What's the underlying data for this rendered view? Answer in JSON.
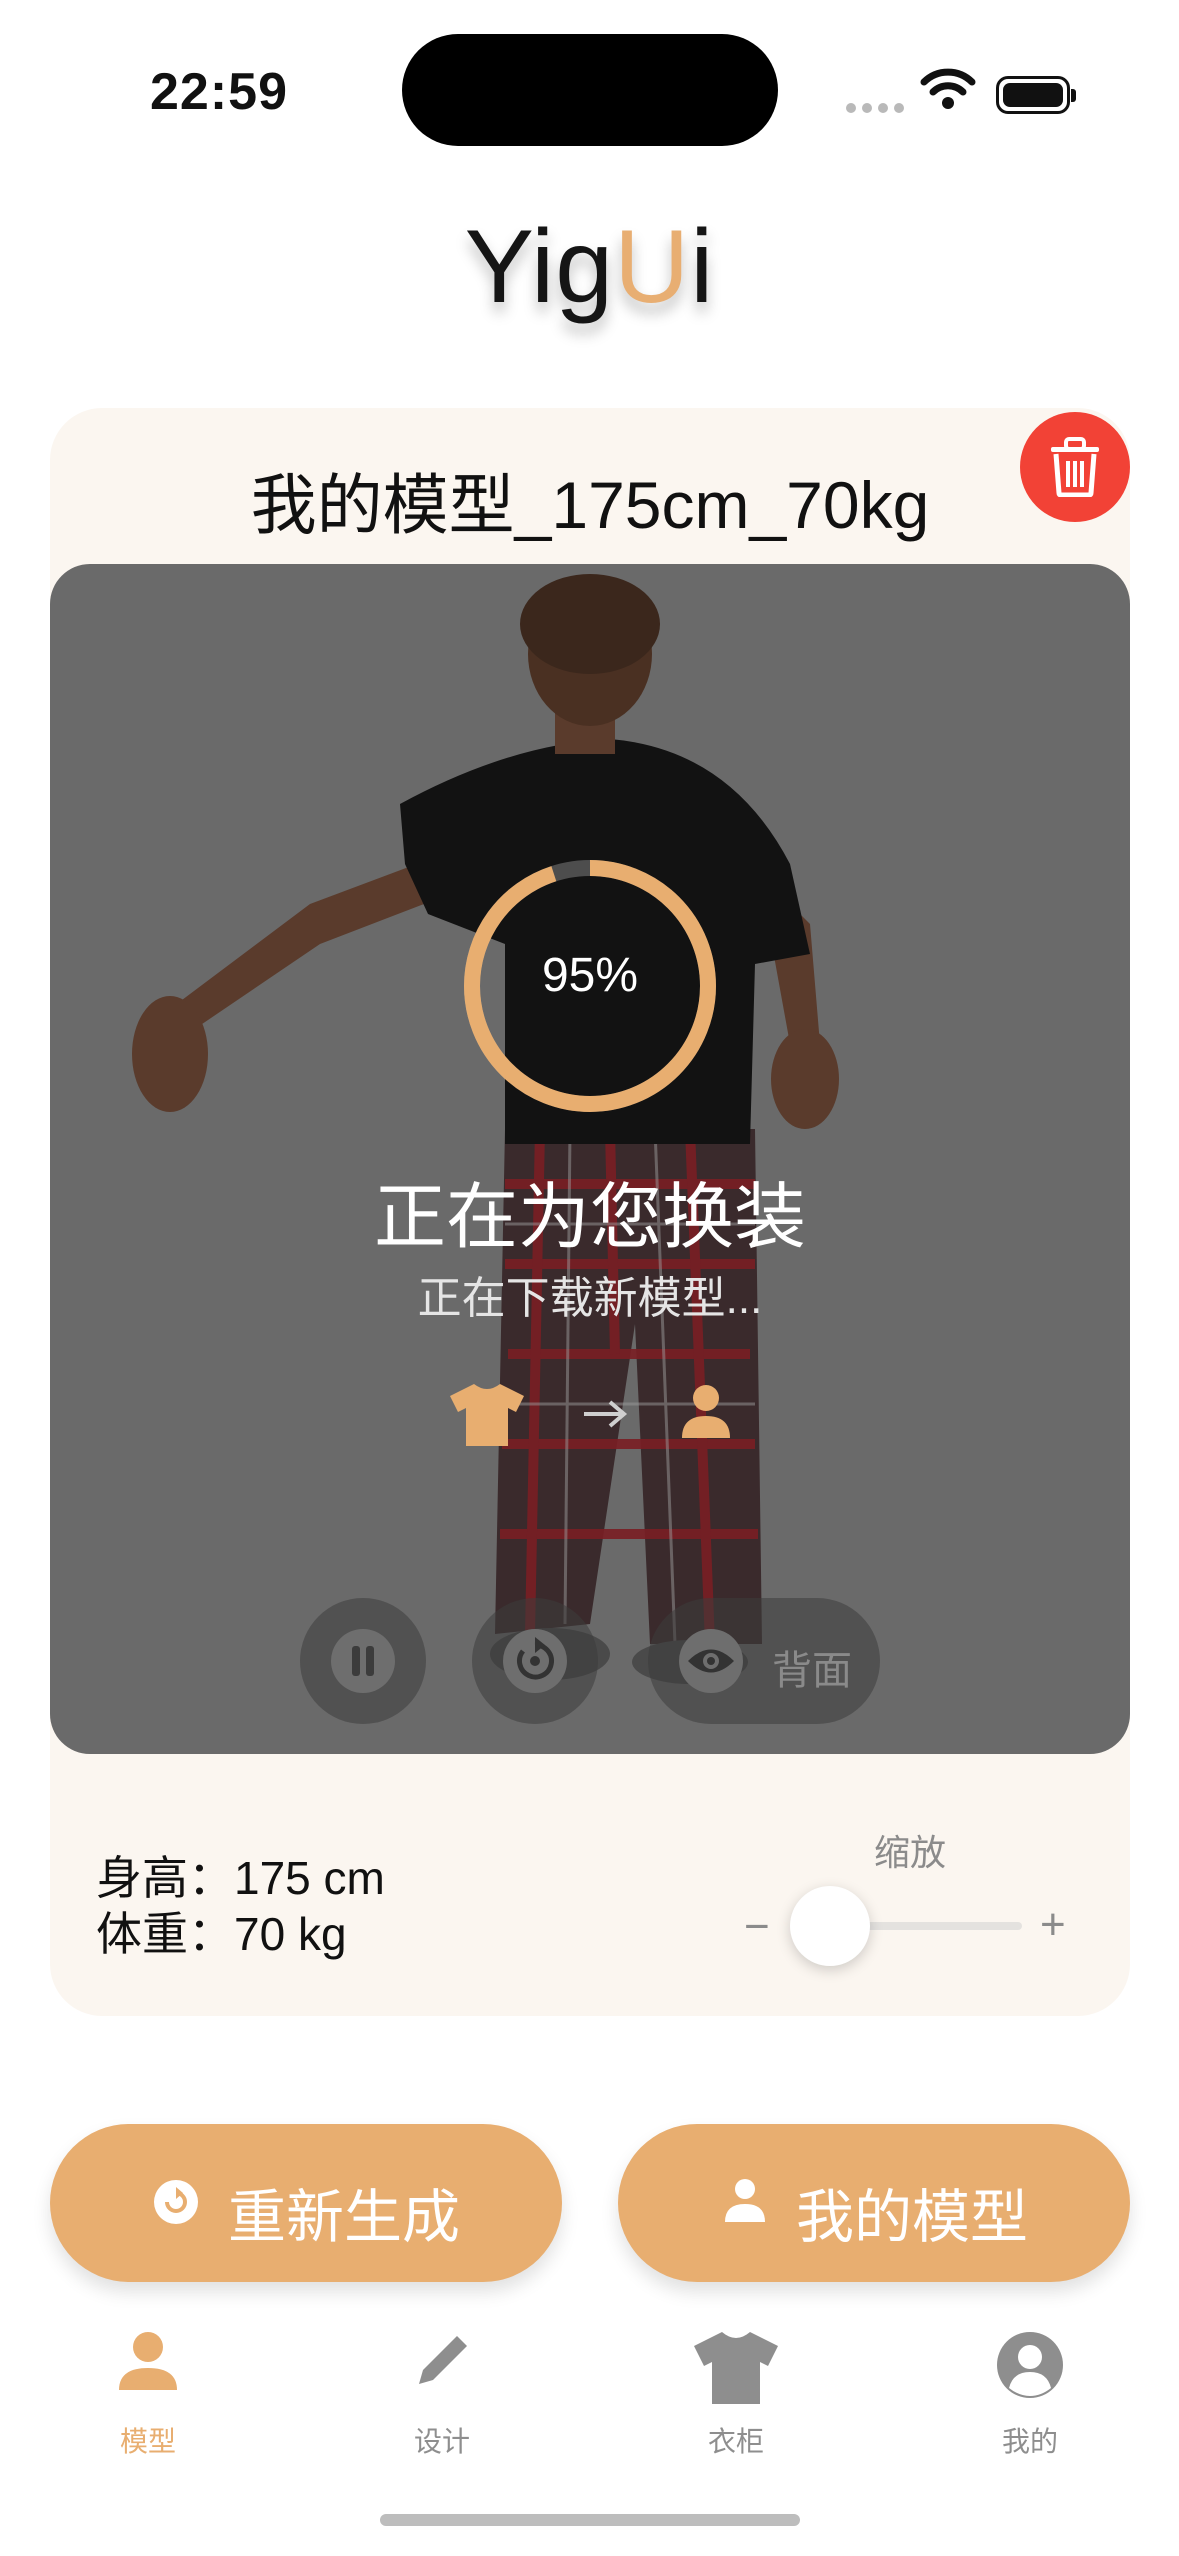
{
  "status_bar": {
    "time": "22:59"
  },
  "app": {
    "logo_part1": "Yig",
    "logo_accent": "U",
    "logo_part2": "i",
    "accent_color": "#e8ae70"
  },
  "model": {
    "name": "我的模型_175cm_70kg"
  },
  "loading": {
    "progress_text": "95%",
    "progress": 0.95,
    "title": "正在为您换装",
    "subtitle": "正在下载新模型..."
  },
  "viewer_controls": {
    "view_label": "背面"
  },
  "info": {
    "height_label": "身高：",
    "height_value": "175 cm",
    "weight_label": "体重：",
    "weight_value": "70 kg"
  },
  "zoom": {
    "label": "缩放",
    "minus": "−",
    "plus": "+"
  },
  "actions": {
    "regenerate": "重新生成",
    "my_model": "我的模型"
  },
  "tabs": [
    {
      "label": "模型",
      "icon": "person-icon",
      "active": true
    },
    {
      "label": "设计",
      "icon": "pencil-icon",
      "active": false
    },
    {
      "label": "衣柜",
      "icon": "tshirt-icon",
      "active": false
    },
    {
      "label": "我的",
      "icon": "profile-icon",
      "active": false
    }
  ]
}
